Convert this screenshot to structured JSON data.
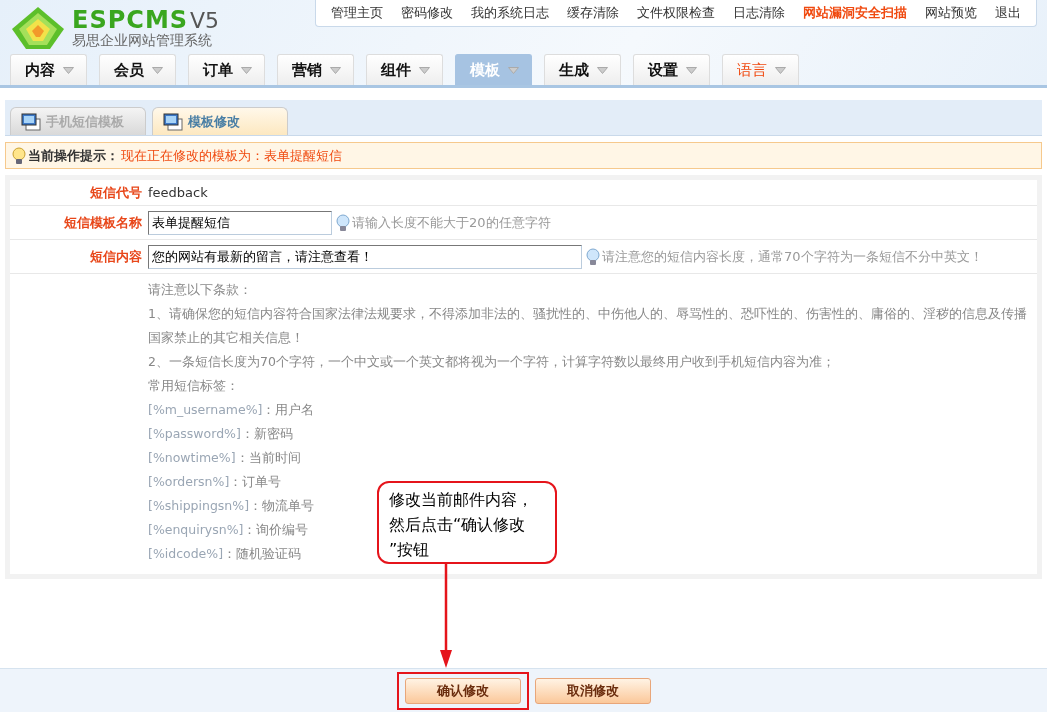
{
  "logo": {
    "wordmark": "ESPCMS",
    "version": "V5",
    "subtitle": "易思企业网站管理系统"
  },
  "top_links": [
    {
      "label": "管理主页",
      "highlight": false
    },
    {
      "label": "密码修改",
      "highlight": false
    },
    {
      "label": "我的系统日志",
      "highlight": false
    },
    {
      "label": "缓存清除",
      "highlight": false
    },
    {
      "label": "文件权限检查",
      "highlight": false
    },
    {
      "label": "日志清除",
      "highlight": false
    },
    {
      "label": "网站漏洞安全扫描",
      "highlight": true
    },
    {
      "label": "网站预览",
      "highlight": false
    },
    {
      "label": "退出",
      "highlight": false
    }
  ],
  "nav_tabs": [
    {
      "label": "内容",
      "selected": false,
      "highlight": false
    },
    {
      "label": "会员",
      "selected": false,
      "highlight": false
    },
    {
      "label": "订单",
      "selected": false,
      "highlight": false
    },
    {
      "label": "营销",
      "selected": false,
      "highlight": false
    },
    {
      "label": "组件",
      "selected": false,
      "highlight": false
    },
    {
      "label": "模板",
      "selected": true,
      "highlight": false
    },
    {
      "label": "生成",
      "selected": false,
      "highlight": false
    },
    {
      "label": "设置",
      "selected": false,
      "highlight": false
    },
    {
      "label": "语言",
      "selected": false,
      "highlight": true
    }
  ],
  "sub_tabs": [
    {
      "label": "手机短信模板",
      "selected": false
    },
    {
      "label": "模板修改",
      "selected": true
    }
  ],
  "tip": {
    "label": "当前操作提示：",
    "message": "现在正在修改的模板为：表单提醒短信"
  },
  "fields": [
    {
      "kind": "static",
      "label": "短信代号",
      "value": "feedback"
    },
    {
      "kind": "input",
      "label": "短信模板名称",
      "value": "表单提醒短信",
      "hint": "请输入长度不能大于20的任意字符"
    },
    {
      "kind": "wide-input",
      "label": "短信内容",
      "value": "您的网站有最新的留言，请注意查看！",
      "hint": "请注意您的短信内容长度，通常70个字符为一条短信不分中英文！"
    }
  ],
  "notes": [
    {
      "kind": "text",
      "text": "请注意以下条款："
    },
    {
      "kind": "text",
      "text": "1、请确保您的短信内容符合国家法律法规要求，不得添加非法的、骚扰性的、中伤他人的、辱骂性的、恐吓性的、伤害性的、庸俗的、淫秽的信息及传播国家禁止的其它相关信息！"
    },
    {
      "kind": "text",
      "text": "2、一条短信长度为70个字符，一个中文或一个英文都将视为一个字符，计算字符数以最终用户收到手机短信内容为准；"
    },
    {
      "kind": "text",
      "text": "常用短信标签："
    },
    {
      "kind": "tag",
      "tag": "[%m_username%]",
      "text": "：用户名"
    },
    {
      "kind": "tag",
      "tag": "[%password%]",
      "text": "：新密码"
    },
    {
      "kind": "tag",
      "tag": "[%nowtime%]",
      "text": "：当前时间"
    },
    {
      "kind": "tag",
      "tag": "[%ordersn%]",
      "text": "：订单号"
    },
    {
      "kind": "tag",
      "tag": "[%shippingsn%]",
      "text": "：物流单号"
    },
    {
      "kind": "tag",
      "tag": "[%enquirysn%]",
      "text": "：询价编号"
    },
    {
      "kind": "tag",
      "tag": "[%idcode%]",
      "text": "：随机验证码"
    }
  ],
  "callout": {
    "lines": [
      "修改当前邮件内容，",
      "然后点击“确认修改",
      "”按钮"
    ]
  },
  "buttons": [
    {
      "label": "确认修改",
      "highlighted": true
    },
    {
      "label": "取消修改",
      "highlighted": false
    }
  ]
}
